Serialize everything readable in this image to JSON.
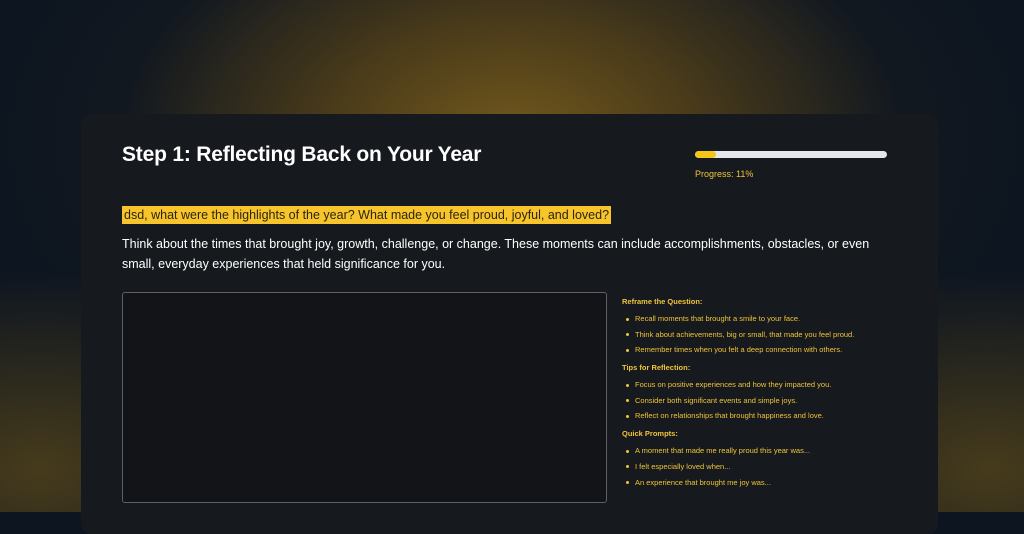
{
  "step": {
    "title": "Step 1: Reflecting Back on Your Year",
    "progress_label": "Progress: 11%",
    "progress_percent": 11,
    "question": "dsd, what were the highlights of the year? What made you feel proud, joyful, and loved?",
    "intro": "Think about the times that brought joy, growth, challenge, or change. These moments can include accomplishments, obstacles, or even small, everyday experiences that held significance for you.",
    "response_value": ""
  },
  "sidebar": {
    "sections": [
      {
        "title": "Reframe the Question:",
        "items": [
          "Recall moments that brought a smile to your face.",
          "Think about achievements, big or small, that made you feel proud.",
          "Remember times when you felt a deep connection with others."
        ]
      },
      {
        "title": "Tips for Reflection:",
        "items": [
          "Focus on positive experiences and how they impacted you.",
          "Consider both significant events and simple joys.",
          "Reflect on relationships that brought happiness and love."
        ]
      },
      {
        "title": "Quick Prompts:",
        "items": [
          "A moment that made me really proud this year was...",
          "I felt especially loved when...",
          "An experience that brought me joy was..."
        ]
      }
    ]
  },
  "colors": {
    "accent": "#f5c518",
    "card_background": "#16191d",
    "page_background": "#0d1520"
  }
}
